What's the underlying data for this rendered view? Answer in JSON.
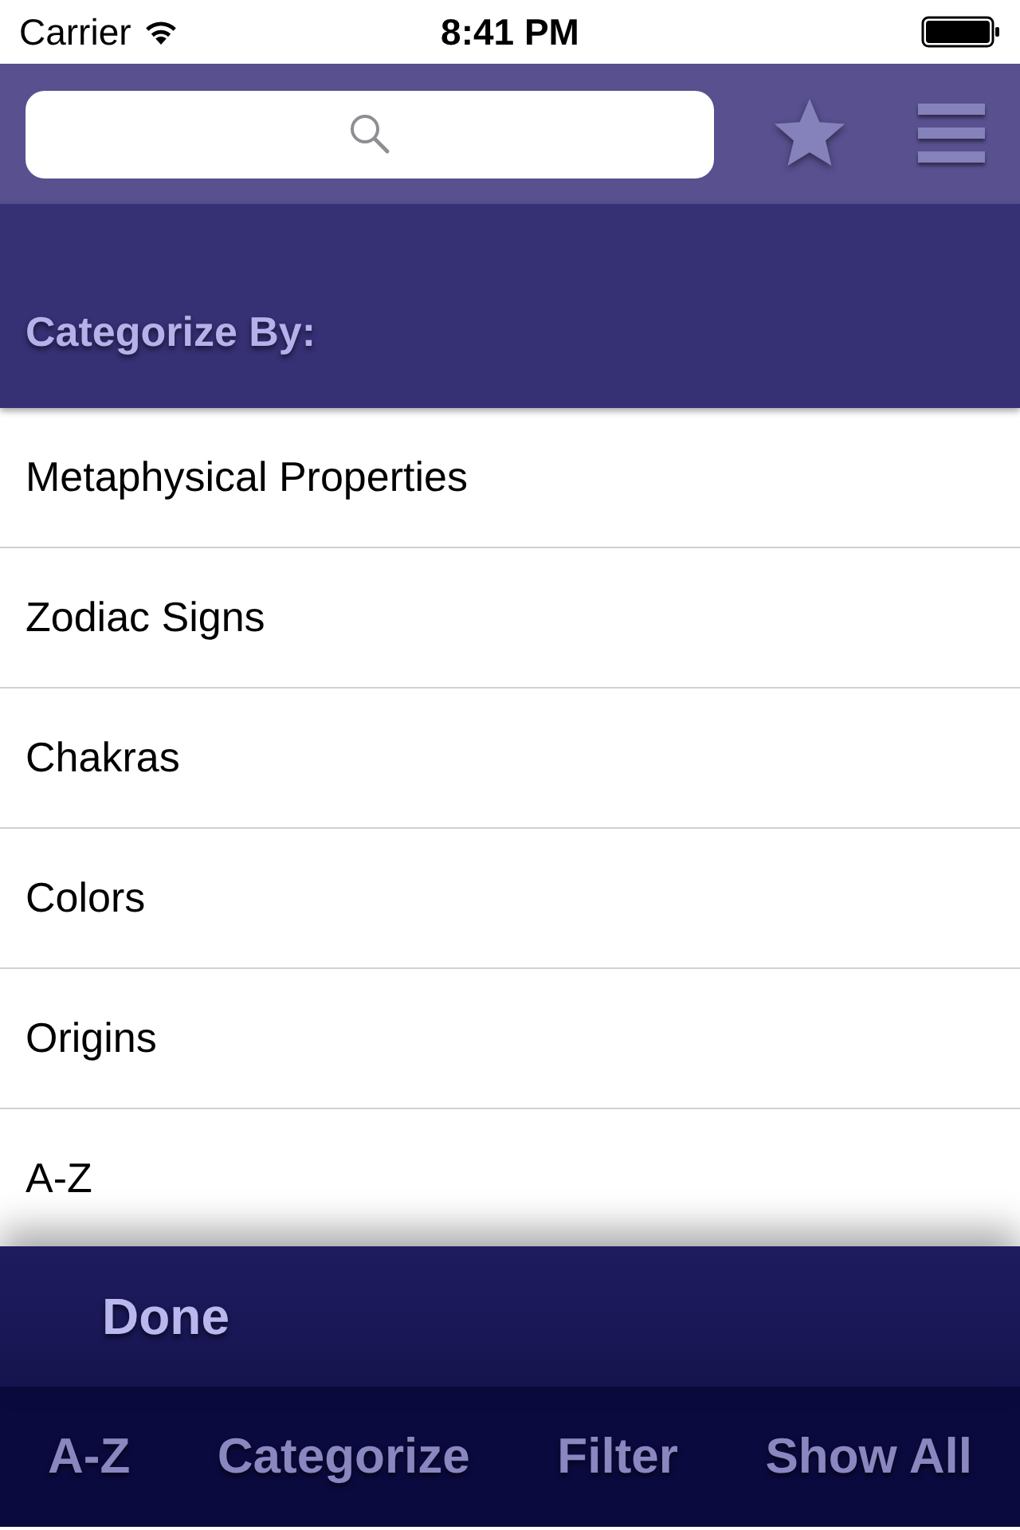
{
  "status_bar": {
    "carrier": "Carrier",
    "time": "8:41 PM"
  },
  "header": {
    "title": "Categorize By:"
  },
  "categories": [
    "Metaphysical Properties",
    "Zodiac Signs",
    "Chakras",
    "Colors",
    "Origins",
    "A-Z"
  ],
  "done_button": "Done",
  "tab_bar": [
    "A-Z",
    "Categorize",
    "Filter",
    "Show All"
  ]
}
